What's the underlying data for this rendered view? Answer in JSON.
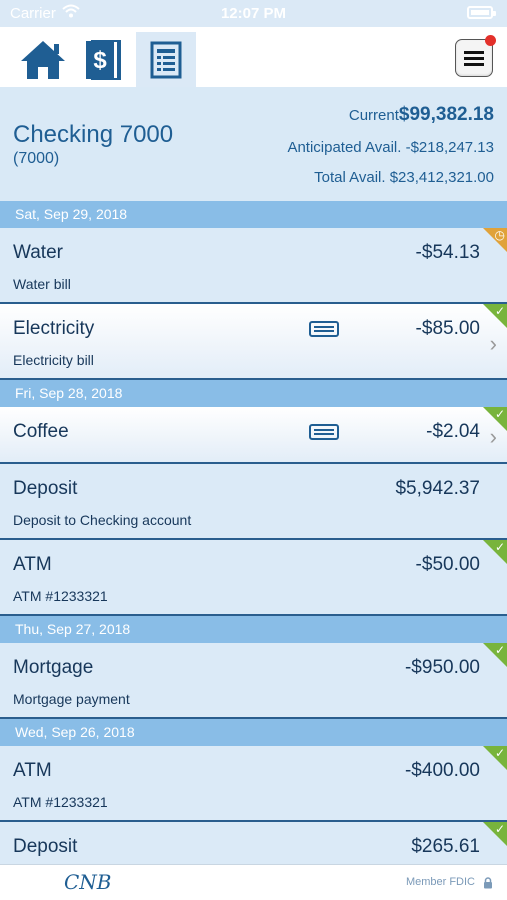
{
  "status_bar": {
    "carrier": "Carrier",
    "time": "12:07 PM"
  },
  "toolbar": {
    "tabs": [
      {
        "name": "home-tab",
        "icon": "home-icon",
        "active": false
      },
      {
        "name": "transfer-tab",
        "icon": "dollar-document-icon",
        "active": false
      },
      {
        "name": "ledger-tab",
        "icon": "register-icon",
        "active": true
      }
    ],
    "menu_icon": "hamburger-menu-icon",
    "has_notification": true
  },
  "account": {
    "name": "Checking 7000",
    "number": "(7000)",
    "current_label": "Current",
    "current_value": "$99,382.18",
    "anticipated_label": "Anticipated Avail.",
    "anticipated_value": "-$218,247.13",
    "total_label": "Total Avail.",
    "total_value": "$23,412,321.00"
  },
  "ledger": [
    {
      "date": "Sat, Sep 29, 2018",
      "transactions": [
        {
          "title": "Water",
          "description": "Water bill",
          "amount": "-$54.13",
          "status": "pending",
          "memo": false,
          "chevron": false,
          "selected": false
        },
        {
          "title": "Electricity",
          "description": "Electricity bill",
          "amount": "-$85.00",
          "status": "cleared",
          "memo": true,
          "chevron": true,
          "selected": true
        }
      ]
    },
    {
      "date": "Fri, Sep 28, 2018",
      "transactions": [
        {
          "title": "Coffee",
          "description": "",
          "amount": "-$2.04",
          "status": "cleared",
          "memo": true,
          "chevron": true,
          "selected": true
        },
        {
          "title": "Deposit",
          "description": "Deposit to Checking account",
          "amount": "$5,942.37",
          "status": "none",
          "memo": false,
          "chevron": false,
          "selected": false
        },
        {
          "title": "ATM",
          "description": "ATM #1233321",
          "amount": "-$50.00",
          "status": "cleared",
          "memo": false,
          "chevron": false,
          "selected": false
        }
      ]
    },
    {
      "date": "Thu, Sep 27, 2018",
      "transactions": [
        {
          "title": "Mortgage",
          "description": "Mortgage payment",
          "amount": "-$950.00",
          "status": "cleared",
          "memo": false,
          "chevron": false,
          "selected": false
        }
      ]
    },
    {
      "date": "Wed, Sep 26, 2018",
      "transactions": [
        {
          "title": "ATM",
          "description": "ATM #1233321",
          "amount": "-$400.00",
          "status": "cleared",
          "memo": false,
          "chevron": false,
          "selected": false
        },
        {
          "title": "Deposit",
          "description": "",
          "amount": "$265.61",
          "status": "cleared",
          "memo": false,
          "chevron": false,
          "selected": false
        }
      ]
    }
  ],
  "footer": {
    "logo_text": "CNB",
    "fdic_text": "Member FDIC",
    "lock_icon": "lock-icon"
  },
  "colors": {
    "primary": "#1f5e93",
    "date_header": "#89bde7",
    "row_background": "#dbeaf7",
    "cleared": "#78b43c",
    "pending": "#e0a23a",
    "notification": "#e3302a"
  }
}
